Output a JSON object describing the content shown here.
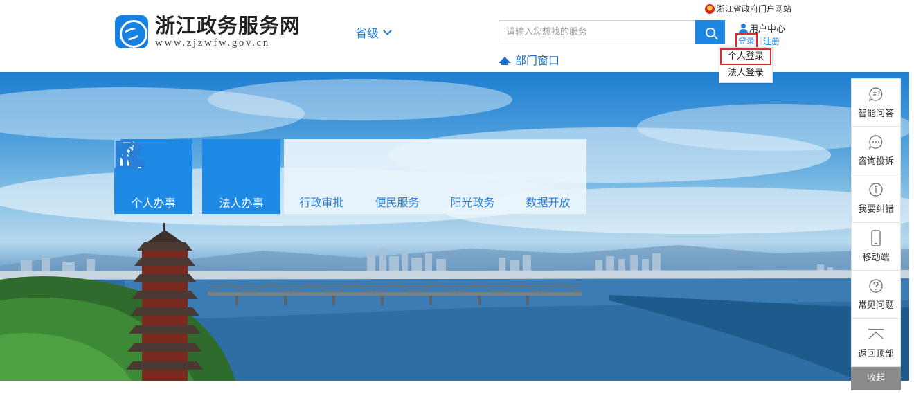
{
  "header": {
    "gov_portal_link": "浙江省政府门户网站",
    "logo_title": "浙江政务服务网",
    "logo_url": "www.zjzwfw.gov.cn",
    "region_selector": "省级",
    "search_placeholder": "请输入您想找的服务",
    "dept_window": "部门窗口",
    "user_center": "用户中心",
    "login": "登录",
    "register": "注册",
    "login_menu": [
      "个人登录",
      "法人登录"
    ]
  },
  "services": {
    "main": [
      {
        "label": "个人办事",
        "icon": "person-icon"
      },
      {
        "label": "法人办事",
        "icon": "corporate-document-icon"
      }
    ],
    "secondary": [
      {
        "label": "行政审批",
        "icon": "clipboard-check-icon"
      },
      {
        "label": "便民服务",
        "icon": "handshake-icon"
      },
      {
        "label": "阳光政务",
        "icon": "document-search-icon"
      },
      {
        "label": "数据开放",
        "icon": "bar-chart-icon"
      }
    ]
  },
  "sidebar": {
    "items": [
      {
        "label": "智能问答",
        "icon": "chat-question-icon"
      },
      {
        "label": "咨询投诉",
        "icon": "chat-dots-icon"
      },
      {
        "label": "我要纠错",
        "icon": "info-icon"
      },
      {
        "label": "移动端",
        "icon": "mobile-icon"
      },
      {
        "label": "常见问题",
        "icon": "question-icon"
      },
      {
        "label": "返回顶部",
        "icon": "back-to-top-icon"
      }
    ],
    "collapse": "收起"
  },
  "colors": {
    "primary_blue": "#1f89e6",
    "highlight_red": "#e02a2a",
    "link_blue": "#1f7fdc"
  }
}
